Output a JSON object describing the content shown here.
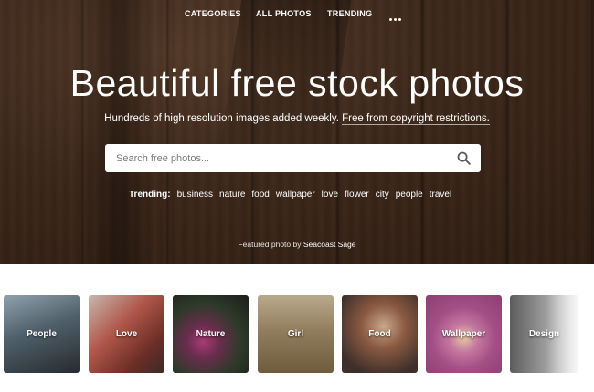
{
  "nav": {
    "items": [
      "CATEGORIES",
      "ALL PHOTOS",
      "TRENDING"
    ],
    "more_icon": "more-dots-icon"
  },
  "hero": {
    "title": "Beautiful free stock photos",
    "subtitle_text": "Hundreds of high resolution images added weekly.",
    "subtitle_link": "Free from copyright restrictions.",
    "search_placeholder": "Search free photos...",
    "search_icon": "search-icon",
    "trending_label": "Trending:",
    "trending_tags": [
      "business",
      "nature",
      "food",
      "wallpaper",
      "love",
      "flower",
      "city",
      "people",
      "travel"
    ],
    "featured_prefix": "Featured photo by",
    "featured_author": "Seacoast Sage"
  },
  "categories": [
    {
      "label": "People",
      "color": "#5b6e7a"
    },
    {
      "label": "Love",
      "color": "#a8584e"
    },
    {
      "label": "Nature",
      "color": "#3c3a35"
    },
    {
      "label": "Girl",
      "color": "#8d7a5e"
    },
    {
      "label": "Food",
      "color": "#6a4f43"
    },
    {
      "label": "Wallpaper",
      "color": "#a24f86"
    },
    {
      "label": "Design",
      "color": "#8a8a8a"
    }
  ]
}
